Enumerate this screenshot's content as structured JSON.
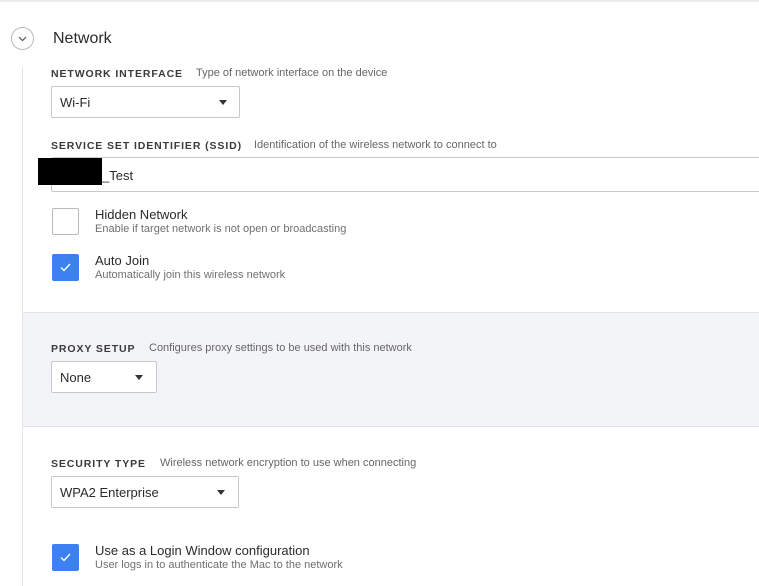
{
  "section": {
    "title": "Network",
    "collapse_icon": "chevron-down-icon"
  },
  "network_interface": {
    "label": "NETWORK INTERFACE",
    "description": "Type of network interface on the device",
    "selected": "Wi-Fi"
  },
  "ssid": {
    "label": "SERVICE SET IDENTIFIER (SSID)",
    "description": "Identification of the wireless network to connect to",
    "value": "_Test"
  },
  "hidden_network": {
    "title": "Hidden Network",
    "description": "Enable if target network is not open or broadcasting",
    "checked": false
  },
  "auto_join": {
    "title": "Auto Join",
    "description": "Automatically join this wireless network",
    "checked": true
  },
  "proxy_setup": {
    "label": "PROXY SETUP",
    "description": "Configures proxy settings to be used with this network",
    "selected": "None"
  },
  "security_type": {
    "label": "SECURITY TYPE",
    "description": "Wireless network encryption to use when connecting",
    "selected": "WPA2 Enterprise"
  },
  "login_window": {
    "title": "Use as a Login Window configuration",
    "description": "User logs in to authenticate the Mac to the network",
    "checked": true
  },
  "colors": {
    "accent": "#3b82f0",
    "band": "#f3f4f8"
  }
}
